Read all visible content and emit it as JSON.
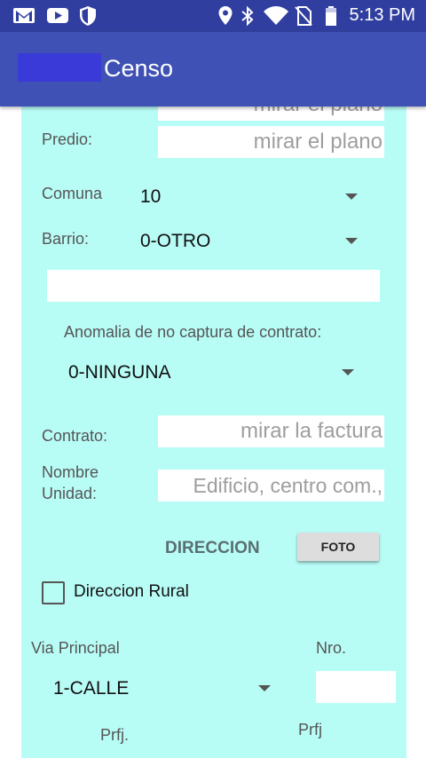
{
  "status_bar": {
    "time": "5:13 PM",
    "icons": [
      "gmail-icon",
      "youtube-icon",
      "shield-icon",
      "location-icon",
      "bluetooth-icon",
      "wifi-icon",
      "no-sim-icon",
      "battery-icon"
    ]
  },
  "app_bar": {
    "title": "Censo"
  },
  "form": {
    "top_clipped_hint": "mirar el plano",
    "predio_label": "Predio:",
    "predio_hint": "mirar el plano",
    "comuna_label": "Comuna",
    "comuna_value": "10",
    "barrio_label": "Barrio:",
    "barrio_value": "0-OTRO",
    "anomalia_label": "Anomalia de no captura de contrato:",
    "anomalia_value": "0-NINGUNA",
    "contrato_label": "Contrato:",
    "contrato_hint": "mirar la factura",
    "nombre_label_1": "Nombre",
    "nombre_label_2": "Unidad:",
    "nombre_hint": "Edificio, centro com.,",
    "direccion_label": "DIRECCION",
    "foto_label": "FOTO",
    "rural_label": "Direccion Rural",
    "via_label": "Via Principal",
    "nro_label": "Nro.",
    "via_value": "1-CALLE",
    "prfj_label_1": "Prfj.",
    "prfj_label_2": "Prfj"
  },
  "colors": {
    "status_bar": "#303f9f",
    "app_bar": "#3f51b5",
    "panel": "#b8fcf6",
    "direccion_text": "#5a6f72"
  }
}
